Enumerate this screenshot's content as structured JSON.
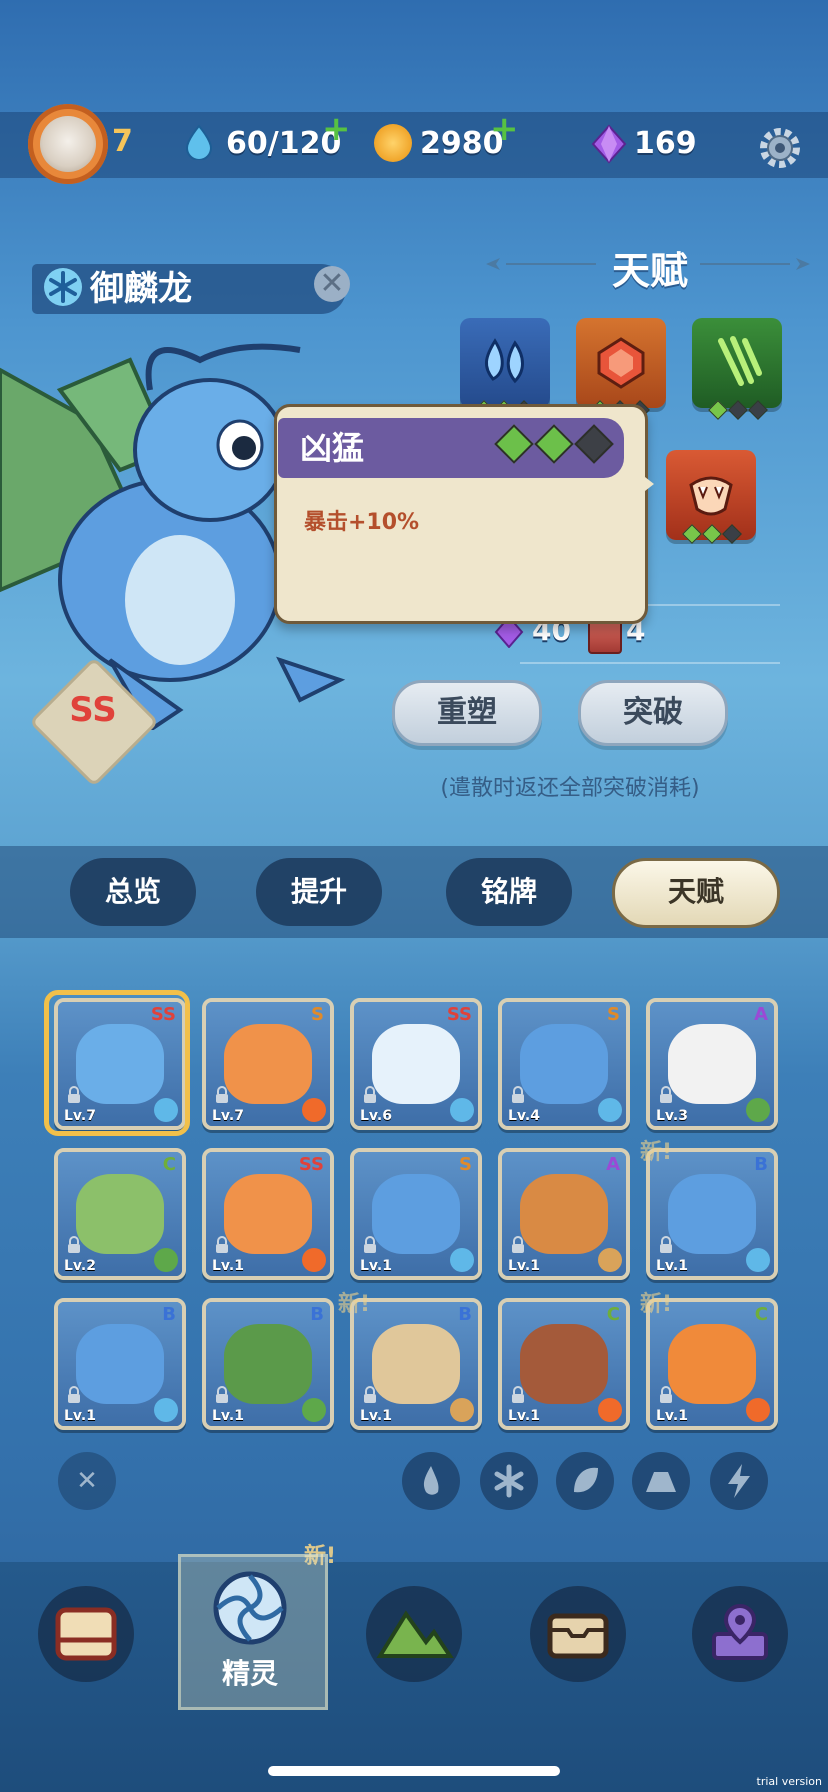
{
  "topbar": {
    "player_level": "7",
    "stamina": "60/120",
    "coins": "2980",
    "gems": "169"
  },
  "creature": {
    "name": "御麟龙",
    "rank": "SS"
  },
  "talent_panel": {
    "title": "天赋",
    "cost_gems": "40",
    "cost_books": "4",
    "reshape_button": "重塑",
    "breakthrough_button": "突破",
    "hint": "(遣散时返还全部突破消耗)"
  },
  "popup": {
    "title": "凶猛",
    "description": "暴击+10%",
    "pips": [
      true,
      true,
      false
    ]
  },
  "talents": [
    {
      "icon": "water-drop-icon",
      "pips": [
        true,
        true,
        false
      ]
    },
    {
      "icon": "crystal-icon",
      "pips": [
        true,
        false,
        false
      ]
    },
    {
      "icon": "claw-slash-icon",
      "pips": [
        true,
        false,
        false
      ]
    },
    {
      "icon": "fang-icon",
      "pips": [
        true,
        true,
        false
      ]
    }
  ],
  "tabs": [
    "总览",
    "提升",
    "铭牌",
    "天赋"
  ],
  "active_tab": "天赋",
  "roster": [
    {
      "rank": "SS",
      "level": "Lv.7",
      "element": "ice"
    },
    {
      "rank": "S",
      "level": "Lv.7",
      "element": "fire"
    },
    {
      "rank": "SS",
      "level": "Lv.6",
      "element": "ice"
    },
    {
      "rank": "S",
      "level": "Lv.4",
      "element": "ice"
    },
    {
      "rank": "A",
      "level": "Lv.3",
      "element": "leaf"
    },
    {
      "rank": "C",
      "level": "Lv.2",
      "element": "leaf"
    },
    {
      "rank": "SS",
      "level": "Lv.1",
      "element": "fire"
    },
    {
      "rank": "S",
      "level": "Lv.1",
      "element": "ice"
    },
    {
      "rank": "A",
      "level": "Lv.1",
      "element": "earth"
    },
    {
      "rank": "B",
      "level": "Lv.1",
      "element": "ice"
    },
    {
      "rank": "B",
      "level": "Lv.1",
      "element": "ice"
    },
    {
      "rank": "B",
      "level": "Lv.1",
      "element": "leaf"
    },
    {
      "rank": "B",
      "level": "Lv.1",
      "element": "earth"
    },
    {
      "rank": "C",
      "level": "Lv.1",
      "element": "fire"
    },
    {
      "rank": "C",
      "level": "Lv.1",
      "element": "fire"
    }
  ],
  "new_tag": "新!",
  "filters": [
    "fire-filter",
    "ice-filter",
    "leaf-filter",
    "earth-filter",
    "lightning-filter"
  ],
  "bottom_nav": {
    "active_label": "精灵"
  },
  "watermark": "trial version",
  "colors": {
    "rank_ss": "#e0423a",
    "rank_s": "#e08a2a",
    "rank_a": "#9a4ad6",
    "rank_b": "#3a72d6",
    "rank_c": "#6fae3a"
  }
}
